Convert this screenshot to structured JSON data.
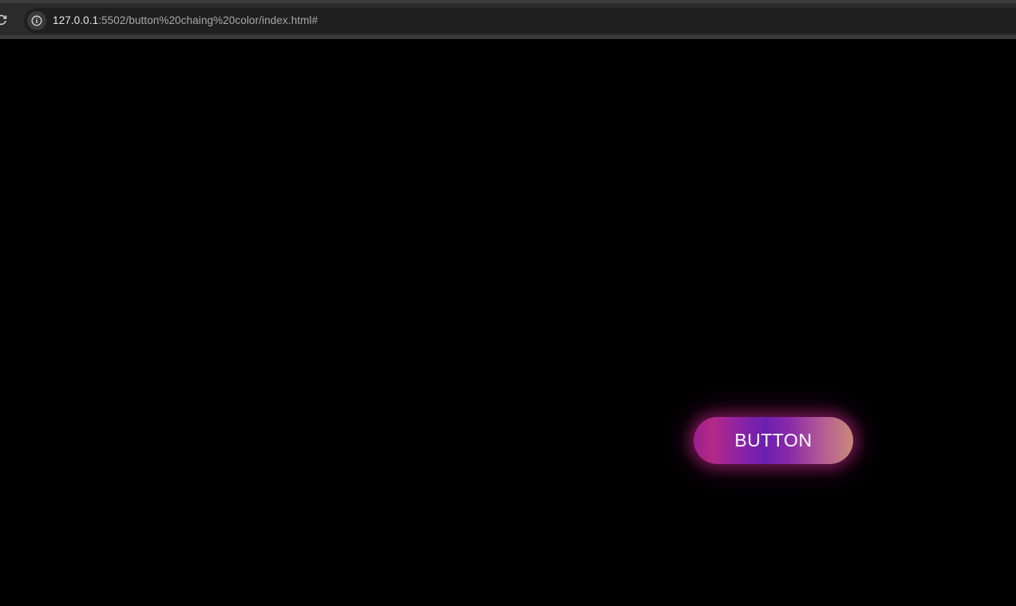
{
  "browser": {
    "url_host": "127.0.0.1",
    "url_path": ":5502/button%20chaing%20color/index.html#"
  },
  "icons": {
    "reload": "reload-icon",
    "site_info": "info-icon"
  },
  "page": {
    "button_label": "BUTTON"
  },
  "colors": {
    "page_background": "#000000",
    "button_gradient": [
      "#9a1f8c",
      "#6a1fb0",
      "#c98a78"
    ],
    "button_glow": "#c8288c"
  }
}
